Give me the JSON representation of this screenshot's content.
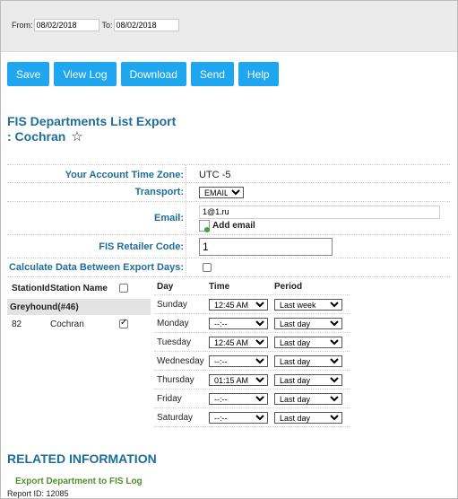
{
  "date_range": {
    "from_label": "From:",
    "from_value": "08/02/2018",
    "to_label": "To:",
    "to_value": "08/02/2018"
  },
  "toolbar": {
    "save": "Save",
    "view_log": "View Log",
    "download": "Download",
    "send": "Send",
    "help": "Help"
  },
  "page": {
    "title_line1": "FIS Departments List Export",
    "title_line2": ": Cochran",
    "star": "☆"
  },
  "form": {
    "tz_label": "Your Account Time Zone:",
    "tz_value": "UTC -5",
    "transport_label": "Transport:",
    "transport_value": "EMAIL",
    "email_label": "Email:",
    "email_value": "1@1.ru",
    "add_email": "Add email",
    "retailer_label": "FIS Retailer Code:",
    "retailer_value": "1",
    "calc_label": "Calculate Data Between Export Days:",
    "calc_checked": false
  },
  "stations": {
    "col_id": "StationId",
    "col_name": "Station Name",
    "group": "Greyhound(#46)",
    "rows": [
      {
        "id": "82",
        "name": "Cochran",
        "checked": true
      }
    ]
  },
  "schedule": {
    "col_day": "Day",
    "col_time": "Time",
    "col_period": "Period",
    "rows": [
      {
        "day": "Sunday",
        "time": "12:45 AM",
        "period": "Last week"
      },
      {
        "day": "Monday",
        "time": "--:--",
        "period": "Last day"
      },
      {
        "day": "Tuesday",
        "time": "12:45 AM",
        "period": "Last day"
      },
      {
        "day": "Wednesday",
        "time": "--:--",
        "period": "Last day"
      },
      {
        "day": "Thursday",
        "time": "01:15 AM",
        "period": "Last day"
      },
      {
        "day": "Friday",
        "time": "--:--",
        "period": "Last day"
      },
      {
        "day": "Saturday",
        "time": "--:--",
        "period": "Last day"
      }
    ]
  },
  "related": {
    "heading": "RELATED INFORMATION",
    "link": "Export Department to FIS Log",
    "report_id": "Report ID: 12085"
  },
  "colors": {
    "accent": "#1ea7f0",
    "label_blue": "#1f6d99",
    "link_green": "#4e8f2c"
  }
}
